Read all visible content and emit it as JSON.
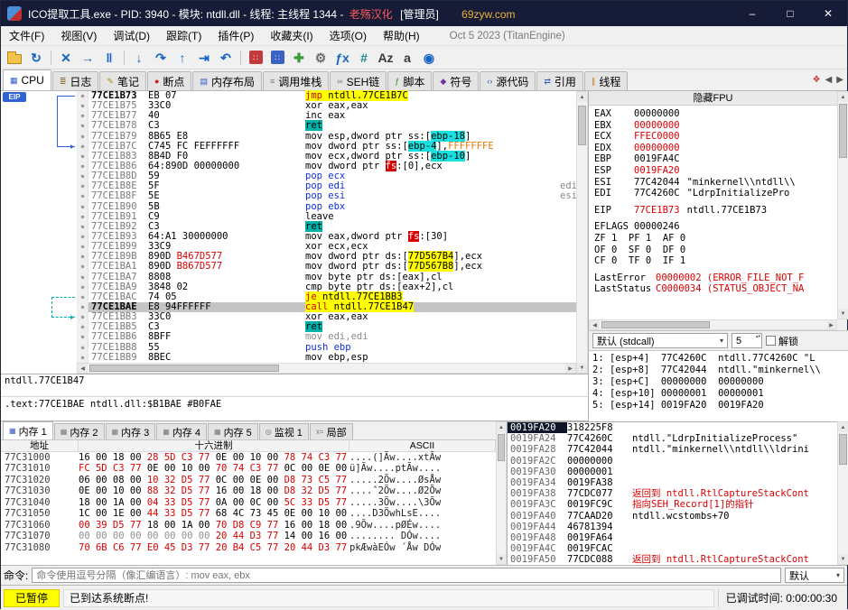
{
  "ui": {
    "caret_down": "▾",
    "arrow_up": "▲",
    "arrow_down": "▼",
    "arrow_left": "◀",
    "arrow_right": "▶",
    "bullet": "●",
    "spin": "▴▾"
  },
  "title": {
    "main": "ICO提取工具.exe - PID: 3940 - 模块: ntdll.dll - 线程: 主线程 1344 -",
    "brand": "老殇汉化",
    "admin": "[管理员]",
    "site": "69zyw.com",
    "minimize": "–",
    "maximize": "□",
    "close": "✕"
  },
  "menu": {
    "right_text": "Oct 5 2023 (TitanEngine)",
    "items": [
      {
        "id": "file",
        "label": "文件(F)"
      },
      {
        "id": "view",
        "label": "视图(V)"
      },
      {
        "id": "debug",
        "label": "调试(D)"
      },
      {
        "id": "trace",
        "label": "跟踪(T)"
      },
      {
        "id": "plugins",
        "label": "插件(P)"
      },
      {
        "id": "favourites",
        "label": "收藏夹(I)"
      },
      {
        "id": "options",
        "label": "选项(O)"
      },
      {
        "id": "help",
        "label": "帮助(H)"
      }
    ]
  },
  "toolbar": {
    "icons": [
      {
        "id": "open-folder-icon",
        "type": "folder"
      },
      {
        "id": "restart-icon",
        "glyph": "↻",
        "color": "#1565C0"
      },
      {
        "sep": true
      },
      {
        "id": "terminate-icon",
        "glyph": "✕",
        "color": "#1565C0"
      },
      {
        "id": "run-icon",
        "glyph": "→",
        "color": "#1565C0"
      },
      {
        "id": "pause-icon",
        "glyph": "‖",
        "color": "#1565C0"
      },
      {
        "sep": true
      },
      {
        "id": "step-into-icon",
        "glyph": "↓",
        "color": "#1565C0"
      },
      {
        "id": "step-over-icon",
        "glyph": "↷",
        "color": "#1565C0"
      },
      {
        "id": "step-out-icon",
        "glyph": "↑",
        "color": "#1565C0"
      },
      {
        "id": "run-to-return-icon",
        "glyph": "⇥",
        "color": "#1565C0"
      },
      {
        "id": "back-icon",
        "glyph": "↶",
        "color": "#1565C0"
      },
      {
        "sep": true
      },
      {
        "id": "trace-into-icon",
        "glyph": "∷",
        "color": "#FFFFFF",
        "bg": "#C23A3A"
      },
      {
        "id": "trace-over-icon",
        "glyph": "∷",
        "color": "#FFFFFF",
        "bg": "#3A62C2"
      },
      {
        "id": "inject-icon",
        "glyph": "✚",
        "color": "#3C9A3C"
      },
      {
        "id": "settings-gear-icon",
        "glyph": "⚙",
        "color": "#6A6A6A"
      },
      {
        "id": "fx-icon",
        "glyph": "ƒx",
        "color": "#1565C0"
      },
      {
        "id": "hash-icon",
        "glyph": "#",
        "color": "#18888A"
      },
      {
        "id": "case-icon",
        "glyph": "Az",
        "color": "#3A3A3A"
      },
      {
        "id": "font-icon",
        "glyph": "a",
        "color": "#3A3A3A"
      },
      {
        "id": "globe-search-icon",
        "glyph": "◉",
        "color": "#1565C0"
      }
    ]
  },
  "tabs": {
    "overflow_icon": "❖",
    "items": [
      {
        "id": "cpu",
        "label": "CPU",
        "glyph": "▦",
        "color": "#2E58C8",
        "sel": true
      },
      {
        "id": "log",
        "label": "日志",
        "glyph": "≣",
        "color": "#8A6A28"
      },
      {
        "id": "notes",
        "label": "笔记",
        "glyph": "✎",
        "color": "#B08820"
      },
      {
        "id": "breakpoints",
        "label": "断点",
        "glyph": "●",
        "color": "#C82020"
      },
      {
        "id": "memory-map",
        "label": "内存布局",
        "glyph": "▤",
        "color": "#2E58C8"
      },
      {
        "id": "call-stack",
        "label": "调用堆栈",
        "glyph": "≡",
        "color": "#7A7A7A"
      },
      {
        "id": "seh",
        "label": "SEH链",
        "glyph": "∞",
        "color": "#7A7A7A"
      },
      {
        "id": "script",
        "label": "脚本",
        "glyph": "ƒ",
        "color": "#2E8A2E"
      },
      {
        "id": "symbols",
        "label": "符号",
        "glyph": "◆",
        "color": "#7030A0"
      },
      {
        "id": "source",
        "label": "源代码",
        "glyph": "‹›",
        "color": "#2E58C8"
      },
      {
        "id": "references",
        "label": "引用",
        "glyph": "⇄",
        "color": "#2E58C8"
      },
      {
        "id": "threads",
        "label": "线程",
        "glyph": "∥",
        "color": "#C87820"
      }
    ]
  },
  "disasm": {
    "eip_label": "EIP",
    "rows": [
      {
        "a": "77CE1B73",
        "eip": true,
        "b": [
          [
            "EB 07",
            ""
          ]
        ],
        "t": [
          [
            "jmp",
            "ry"
          ],
          [
            " ",
            "y"
          ],
          [
            "ntdll.77CE1B7C",
            "y"
          ]
        ]
      },
      {
        "a": "77CE1B75",
        "b": [
          [
            "33C0",
            ""
          ]
        ],
        "t": [
          [
            "xor eax,eax",
            ""
          ]
        ]
      },
      {
        "a": "77CE1B77",
        "b": [
          [
            "40",
            ""
          ]
        ],
        "t": [
          [
            "inc eax",
            ""
          ]
        ]
      },
      {
        "a": "77CE1B78",
        "b": [
          [
            "C3",
            ""
          ]
        ],
        "t": [
          [
            "ret",
            "tl"
          ]
        ]
      },
      {
        "a": "77CE1B79",
        "b": [
          [
            "8B65 E8",
            ""
          ]
        ],
        "t": [
          [
            "mov esp,dword ptr ss:[",
            ""
          ],
          [
            "ebp-18",
            "cyn"
          ],
          [
            "]",
            ""
          ]
        ]
      },
      {
        "a": "77CE1B7C",
        "b": [
          [
            "C745 FC FEFFFFFF",
            ""
          ]
        ],
        "t": [
          [
            "mov dword ptr ss:[",
            ""
          ],
          [
            "ebp-4",
            "cyn"
          ],
          [
            "],",
            ""
          ],
          [
            "FFFFFFFE",
            "or"
          ]
        ]
      },
      {
        "a": "77CE1B83",
        "b": [
          [
            "8B4D F0",
            ""
          ]
        ],
        "t": [
          [
            "mov ecx,dword ptr ss:[",
            ""
          ],
          [
            "ebp-10",
            "cyn"
          ],
          [
            "]",
            ""
          ]
        ]
      },
      {
        "a": "77CE1B86",
        "b": [
          [
            "64:890D 00000000",
            ""
          ]
        ],
        "t": [
          [
            "mov dword ptr ",
            ""
          ],
          [
            "fs",
            "sg"
          ],
          [
            ":[0],ecx",
            ""
          ]
        ]
      },
      {
        "a": "77CE1B8D",
        "b": [
          [
            "59",
            ""
          ]
        ],
        "t": [
          [
            "pop ecx",
            "bl"
          ]
        ]
      },
      {
        "a": "77CE1B8E",
        "b": [
          [
            "5F",
            ""
          ]
        ],
        "t": [
          [
            "pop edi",
            "bl"
          ]
        ],
        "cm": "edi"
      },
      {
        "a": "77CE1B8F",
        "b": [
          [
            "5E",
            ""
          ]
        ],
        "t": [
          [
            "pop esi",
            "bl"
          ]
        ],
        "cm": "esi"
      },
      {
        "a": "77CE1B90",
        "b": [
          [
            "5B",
            ""
          ]
        ],
        "t": [
          [
            "pop ebx",
            "bl"
          ]
        ]
      },
      {
        "a": "77CE1B91",
        "b": [
          [
            "C9",
            ""
          ]
        ],
        "t": [
          [
            "leave",
            ""
          ]
        ]
      },
      {
        "a": "77CE1B92",
        "b": [
          [
            "C3",
            ""
          ]
        ],
        "t": [
          [
            "ret",
            "tl"
          ]
        ]
      },
      {
        "a": "77CE1B93",
        "b": [
          [
            "64:A1 30000000",
            ""
          ]
        ],
        "t": [
          [
            "mov eax,dword ptr ",
            ""
          ],
          [
            "fs",
            "sg"
          ],
          [
            ":[30]",
            ""
          ]
        ]
      },
      {
        "a": "77CE1B99",
        "b": [
          [
            "33C9",
            ""
          ]
        ],
        "t": [
          [
            "xor ecx,ecx",
            ""
          ]
        ]
      },
      {
        "a": "77CE1B9B",
        "b": [
          [
            "890D ",
            ""
          ],
          [
            "B467D577",
            "rd"
          ]
        ],
        "t": [
          [
            "mov dword ptr ds:[",
            ""
          ],
          [
            "77D567B4",
            "y"
          ],
          [
            "],ecx",
            ""
          ]
        ]
      },
      {
        "a": "77CE1BA1",
        "b": [
          [
            "890D ",
            ""
          ],
          [
            "B867D577",
            "rd"
          ]
        ],
        "t": [
          [
            "mov dword ptr ds:[",
            ""
          ],
          [
            "77D567B8",
            "y"
          ],
          [
            "],ecx",
            ""
          ]
        ]
      },
      {
        "a": "77CE1BA7",
        "b": [
          [
            "8808",
            ""
          ]
        ],
        "t": [
          [
            "mov byte ptr ds:[eax],cl",
            ""
          ]
        ]
      },
      {
        "a": "77CE1BA9",
        "b": [
          [
            "3848 02",
            ""
          ]
        ],
        "t": [
          [
            "cmp byte ptr ds:[eax+2],cl",
            ""
          ]
        ]
      },
      {
        "a": "77CE1BAC",
        "b": [
          [
            "74 05",
            ""
          ]
        ],
        "t": [
          [
            "je",
            "ry"
          ],
          [
            " ",
            "y"
          ],
          [
            "ntdll.77CE1BB3",
            "y"
          ]
        ]
      },
      {
        "a": "77CE1BAE",
        "sel": true,
        "b": [
          [
            "E8 94FFFFFF",
            ""
          ]
        ],
        "t": [
          [
            "call",
            "ry"
          ],
          [
            " ",
            "y"
          ],
          [
            "ntdll.77CE1B47",
            "y"
          ]
        ]
      },
      {
        "a": "77CE1BB3",
        "b": [
          [
            "33C0",
            ""
          ]
        ],
        "t": [
          [
            "xor eax,eax",
            ""
          ]
        ]
      },
      {
        "a": "77CE1BB5",
        "b": [
          [
            "C3",
            ""
          ]
        ],
        "t": [
          [
            "ret",
            "tl"
          ]
        ]
      },
      {
        "a": "77CE1BB6",
        "b": [
          [
            "8BFF",
            ""
          ]
        ],
        "t": [
          [
            "mov edi,edi",
            "gy"
          ]
        ]
      },
      {
        "a": "77CE1BB8",
        "b": [
          [
            "55",
            ""
          ]
        ],
        "t": [
          [
            "push ebp",
            "bl"
          ]
        ]
      },
      {
        "a": "77CE1BB9",
        "b": [
          [
            "8BEC",
            ""
          ]
        ],
        "t": [
          [
            "mov ebp,esp",
            ""
          ]
        ]
      }
    ]
  },
  "info": {
    "call_target": "ntdll.77CE1B47",
    "location": ".text:77CE1BAE ntdll.dll:$B1BAE #B0FAE"
  },
  "registers": {
    "hide_fpu": "隐藏FPU",
    "lines": [
      {
        "n": "EAX",
        "v": "00000000"
      },
      {
        "n": "EBX",
        "v": "00000000",
        "vc": "rd"
      },
      {
        "n": "ECX",
        "v": "FFEC0000",
        "vc": "rd"
      },
      {
        "n": "EDX",
        "v": "00000000",
        "vc": "rd"
      },
      {
        "n": "EBP",
        "v": "0019FA4C"
      },
      {
        "n": "ESP",
        "v": "0019FA20",
        "vc": "rd"
      },
      {
        "n": "ESI",
        "v": "77C42044",
        "c": "\"minkernel\\\\ntdll\\\\"
      },
      {
        "n": "EDI",
        "v": "77C4260C",
        "c": "\"LdrpInitializePro"
      },
      {
        "blank": true
      },
      {
        "n": "EIP",
        "v": "77CE1B73",
        "vc": "rd",
        "c": "ntdll.77CE1B73"
      },
      {
        "blank": true
      },
      {
        "n": "EFLAGS",
        "v": "00000246"
      },
      {
        "text": "ZF 1  PF 1  AF 0"
      },
      {
        "text": "OF 0  SF 0  DF 0"
      },
      {
        "text": "CF 0  TF 0  IF 1"
      },
      {
        "blank": true
      },
      {
        "n": "LastError",
        "v": "00000002 (ERROR_FILE_NOT_F",
        "vc": "rd"
      },
      {
        "n": "LastStatus",
        "v": "C0000034 (STATUS_OBJECT_NA",
        "vc": "rd"
      }
    ],
    "convention": {
      "label": "默认 (stdcall)",
      "count": "5",
      "unlock": "解锁"
    },
    "args": [
      "1: [esp+4]  77C4260C  ntdll.77C4260C \"L",
      "2: [esp+8]  77C42044  ntdll.\"minkernel\\\\",
      "3: [esp+C]  00000000  00000000",
      "4: [esp+10] 00000001  00000001",
      "5: [esp+14] 0019FA20  0019FA20"
    ]
  },
  "dump": {
    "headers": {
      "addr": "地址",
      "hex": "十六进制",
      "ascii": "ASCII"
    },
    "tabs": [
      {
        "id": "memory-1",
        "label": "内存 1",
        "glyph": "▦",
        "sel": true
      },
      {
        "id": "memory-2",
        "label": "内存 2",
        "glyph": "▦"
      },
      {
        "id": "memory-3",
        "label": "内存 3",
        "glyph": "▦"
      },
      {
        "id": "memory-4",
        "label": "内存 4",
        "glyph": "▦"
      },
      {
        "id": "memory-5",
        "label": "内存 5",
        "glyph": "▦"
      },
      {
        "id": "watch-1",
        "label": "监视 1",
        "glyph": "◎"
      },
      {
        "id": "locals",
        "label": "局部",
        "glyph": "x="
      }
    ],
    "rows": [
      {
        "a": "77C31000",
        "h": [
          [
            "16 00 18 00 ",
            ""
          ],
          [
            "28 5D C3 77",
            "rd"
          ],
          [
            " 0E 00 10 00 ",
            ""
          ],
          [
            "78 74 C3 77",
            "rd"
          ]
        ],
        "s": "....(]Ãw....xtÃw"
      },
      {
        "a": "77C31010",
        "h": [
          [
            "FC 5D C3 77",
            "rd"
          ],
          [
            " 0E 00 10 00 ",
            ""
          ],
          [
            "70 74 C3 77",
            "rd"
          ],
          [
            " 0C 00 0E 00",
            ""
          ]
        ],
        "s": "ü]Ãw....ptÃw...."
      },
      {
        "a": "77C31020",
        "h": [
          [
            "06 00 08 00 ",
            ""
          ],
          [
            "10 32 D5 77",
            "rd"
          ],
          [
            " 0C 00 0E 00 ",
            ""
          ],
          [
            "D8 73 C5 77",
            "rd"
          ]
        ],
        "s": ".....2Õw....ØsÅw"
      },
      {
        "a": "77C31030",
        "h": [
          [
            "0E 00 10 00 ",
            ""
          ],
          [
            "88 32 D5 77",
            "rd"
          ],
          [
            " 16 00 18 00 ",
            ""
          ],
          [
            "D8 32 D5 77",
            "rd"
          ]
        ],
        "s": "....ˆ2Õw....Ø2Õw"
      },
      {
        "a": "77C31040",
        "h": [
          [
            "18 00 1A 00 ",
            ""
          ],
          [
            "04 33 D5 77",
            "rd"
          ],
          [
            " 0A 00 0C 00 ",
            ""
          ],
          [
            "5C 33 D5 77",
            "rd"
          ]
        ],
        "s": ".....3Õw....\\3Õw"
      },
      {
        "a": "77C31050",
        "h": [
          [
            "1C 00 1E 00 ",
            ""
          ],
          [
            "44 33 D5 77",
            "rd"
          ],
          [
            " 68 4C 73 45 0E 00 10 00",
            ""
          ]
        ],
        "s": "....D3ÕwhLsE...."
      },
      {
        "a": "77C31060",
        "h": [
          [
            "00 39 D5 77",
            "rd"
          ],
          [
            " 18 00 1A 00 ",
            ""
          ],
          [
            "70 D8 C9 77",
            "rd"
          ],
          [
            " 16 00 18 00",
            ""
          ]
        ],
        "s": ".9Õw....pØÉw...."
      },
      {
        "a": "77C31070",
        "h": [
          [
            "00 00 00 00 00 00 00 00",
            "z"
          ],
          [
            " ",
            ""
          ],
          [
            "20 44 D3 77",
            "rd"
          ],
          [
            " 14 00 16 00",
            ""
          ]
        ],
        "s": "........ DÓw...."
      },
      {
        "a": "77C31080",
        "h": [
          [
            "70 6B C6 77",
            "rd"
          ],
          [
            " ",
            ""
          ],
          [
            "E0 45 D3 77",
            "rd"
          ],
          [
            " ",
            ""
          ],
          [
            "20 B4 C5 77",
            "rd"
          ],
          [
            " ",
            ""
          ],
          [
            "20 44 D3 77",
            "rd"
          ]
        ],
        "s": "pkÆwàEÓw ´Åw DÓw"
      }
    ]
  },
  "stack": {
    "rows": [
      {
        "a": "0019FA20",
        "v": "318225F8",
        "sel": true
      },
      {
        "a": "0019FA24",
        "v": "77C4260C",
        "c": "ntdll.\"LdrpInitializeProcess\""
      },
      {
        "a": "0019FA28",
        "v": "77C42044",
        "c": "ntdll.\"minkernel\\\\ntdll\\\\ldrini"
      },
      {
        "a": "0019FA2C",
        "v": "00000000"
      },
      {
        "a": "0019FA30",
        "v": "00000001"
      },
      {
        "a": "0019FA34",
        "v": "0019FA38"
      },
      {
        "a": "0019FA38",
        "v": "77CDC077",
        "c": "返回到 ntdll.RtlCaptureStackCont",
        "cc": "rd"
      },
      {
        "a": "0019FA3C",
        "v": "0019FC9C",
        "c": "指向SEH_Record[1]的指针",
        "cc": "rd"
      },
      {
        "a": "0019FA40",
        "v": "77CAAD20",
        "c": "ntdll.wcstombs+70"
      },
      {
        "a": "0019FA44",
        "v": "46781394"
      },
      {
        "a": "0019FA48",
        "v": "0019FA64"
      },
      {
        "a": "0019FA4C",
        "v": "0019FCAC"
      },
      {
        "a": "0019FA50",
        "v": "77CDC088",
        "c": "返回到 ntdll.RtlCaptureStackCont",
        "cc": "rd"
      }
    ]
  },
  "command": {
    "label": "命令:",
    "placeholder": "命令使用逗号分隔（像汇编语言）: mov eax, ebx",
    "dropdown": "默认"
  },
  "status": {
    "state": "已暂停",
    "message": "已到达系统断点!",
    "time": "已调试时间: 0:00:00:30"
  }
}
